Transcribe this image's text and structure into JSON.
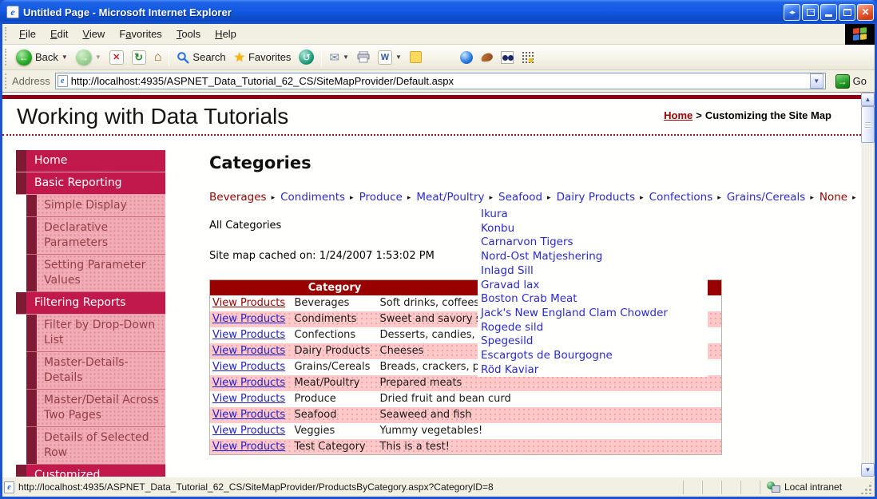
{
  "window": {
    "title": "Untitled Page - Microsoft Internet Explorer"
  },
  "menu_bar": {
    "items": [
      {
        "label": "File",
        "accel": 0
      },
      {
        "label": "Edit",
        "accel": 0
      },
      {
        "label": "View",
        "accel": 0
      },
      {
        "label": "Favorites",
        "accel": 1
      },
      {
        "label": "Tools",
        "accel": 0
      },
      {
        "label": "Help",
        "accel": 0
      }
    ]
  },
  "toolbar": {
    "back_label": "Back",
    "search_label": "Search",
    "favorites_label": "Favorites",
    "icons": [
      "back-icon",
      "forward-icon",
      "stop-icon",
      "refresh-icon",
      "home-icon",
      "search-icon",
      "favorites-star-icon",
      "history-icon",
      "mail-icon",
      "print-icon",
      "edit-word-icon",
      "discuss-note-icon",
      "messenger-sphere-icon",
      "addon-icon",
      "research-icon",
      "debugger-grid-icon"
    ]
  },
  "address_bar": {
    "label": "Address",
    "url": "http://localhost:4935/ASPNET_Data_Tutorial_62_CS/SiteMapProvider/Default.aspx",
    "go_label": "Go"
  },
  "page": {
    "site_title": "Working with Data Tutorials",
    "breadcrumb": {
      "home": "Home",
      "separator": ">",
      "current": "Customizing the Site Map"
    },
    "sidebar": {
      "items": [
        {
          "label": "Home",
          "level": 1
        },
        {
          "label": "Basic Reporting",
          "level": 1
        },
        {
          "label": "Simple Display",
          "level": 2
        },
        {
          "label": "Declarative Parameters",
          "level": 2
        },
        {
          "label": "Setting Parameter Values",
          "level": 2
        },
        {
          "label": "Filtering Reports",
          "level": 1
        },
        {
          "label": "Filter by Drop-Down List",
          "level": 2
        },
        {
          "label": "Master-Details-Details",
          "level": 2
        },
        {
          "label": "Master/Detail Across Two Pages",
          "level": 2
        },
        {
          "label": "Details of Selected Row",
          "level": 2
        },
        {
          "label": "Customized",
          "level": 1
        }
      ]
    },
    "main": {
      "heading": "Categories",
      "category_menu": {
        "arrow_icon": "▸",
        "items": [
          {
            "label": "Beverages",
            "visited": true
          },
          {
            "label": "Condiments",
            "visited": false
          },
          {
            "label": "Produce",
            "visited": false
          },
          {
            "label": "Meat/Poultry",
            "visited": false
          },
          {
            "label": "Seafood",
            "visited": false
          },
          {
            "label": "Dairy Products",
            "visited": false
          },
          {
            "label": "Confections",
            "visited": false
          },
          {
            "label": "Grains/Cereals",
            "visited": false
          },
          {
            "label": "None",
            "visited": true
          }
        ]
      },
      "all_categories_label": "All Categories",
      "cache_note": "Site map cached on: 1/24/2007 1:53:02 PM",
      "products_submenu": {
        "items": [
          "Ikura",
          "Konbu",
          "Carnarvon Tigers",
          "Nord-Ost Matjeshering",
          "Inlagd Sill",
          "Gravad lax",
          "Boston Crab Meat",
          "Jack's New England Clam Chowder",
          "Rogede sild",
          "Spegesild",
          "Escargots de Bourgogne",
          "Röd Kaviar"
        ]
      },
      "table": {
        "column_header": "Category",
        "rows": [
          {
            "action": "View Products",
            "category": "Beverages",
            "description": "Soft drinks, coffees, teas, beers, and ales",
            "action_visited": true
          },
          {
            "action": "View Products",
            "category": "Condiments",
            "description": "Sweet and savory sauces, relishes, spreads, and seasonings",
            "action_visited": false
          },
          {
            "action": "View Products",
            "category": "Confections",
            "description": "Desserts, candies, and sweet breads",
            "action_visited": false
          },
          {
            "action": "View Products",
            "category": "Dairy Products",
            "description": "Cheeses",
            "action_visited": false
          },
          {
            "action": "View Products",
            "category": "Grains/Cereals",
            "description": "Breads, crackers, pasta, and cereal",
            "action_visited": false
          },
          {
            "action": "View Products",
            "category": "Meat/Poultry",
            "description": "Prepared meats",
            "action_visited": false
          },
          {
            "action": "View Products",
            "category": "Produce",
            "description": "Dried fruit and bean curd",
            "action_visited": false
          },
          {
            "action": "View Products",
            "category": "Seafood",
            "description": "Seaweed and fish",
            "action_visited": false
          },
          {
            "action": "View Products",
            "category": "Veggies",
            "description": "Yummy vegetables!",
            "action_visited": false
          },
          {
            "action": "View Products",
            "category": "Test Category",
            "description": "This is a test!",
            "action_visited": false
          }
        ]
      }
    }
  },
  "status_bar": {
    "url": "http://localhost:4935/ASPNET_Data_Tutorial_62_CS/SiteMapProvider/ProductsByCategory.aspx?CategoryID=8",
    "zone": "Local intranet"
  },
  "colors": {
    "table_header_maroon": "#990000",
    "sidebar_crimson": "#c1194b",
    "sidebar_accent_maroon": "#7d1b35",
    "sidebar_pink": "#f2acb6",
    "row_pink": "#ffc9c9",
    "link_blue": "#2222cc",
    "visited_maroon": "#990000",
    "page_topbar_red": "#8e0013"
  }
}
